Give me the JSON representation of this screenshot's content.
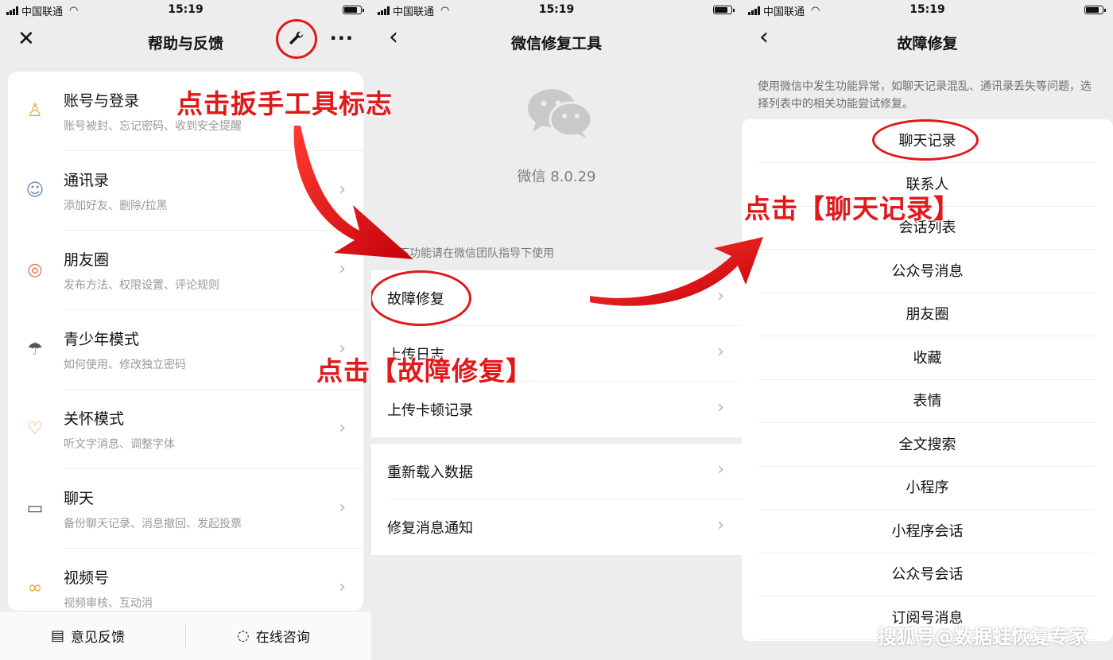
{
  "status": {
    "carrier": "中国联通",
    "time": "15:19"
  },
  "help": {
    "title": "帮助与反馈",
    "items": [
      {
        "icon": "user-icon",
        "title": "账号与登录",
        "sub": "账号被封、忘记密码、收到安全提醒"
      },
      {
        "icon": "contacts-icon",
        "title": "通讯录",
        "sub": "添加好友、删除/拉黑"
      },
      {
        "icon": "moments-icon",
        "title": "朋友圈",
        "sub": "发布方法、权限设置、评论规则"
      },
      {
        "icon": "umbrella-icon",
        "title": "青少年模式",
        "sub": "如何使用、修改独立密码"
      },
      {
        "icon": "care-icon",
        "title": "关怀模式",
        "sub": "听文字消息、调整字体"
      },
      {
        "icon": "chat-icon",
        "title": "聊天",
        "sub": "备份聊天记录、消息撤回、发起投票"
      },
      {
        "icon": "channels-icon",
        "title": "视频号",
        "sub": "视频审核、互动消"
      }
    ],
    "bottom": {
      "feedback": "意见反馈",
      "consult": "在线咨询"
    }
  },
  "repair": {
    "title": "微信修复工具",
    "version": "微信 8.0.29",
    "hint": "以下功能请在微信团队指导下使用",
    "rows": [
      "故障修复",
      "上传日志",
      "上传卡顿记录"
    ],
    "rows2": [
      "重新载入数据",
      "修复消息通知"
    ]
  },
  "fault": {
    "title": "故障修复",
    "desc": "使用微信中发生功能异常，如聊天记录混乱、通讯录丢失等问题，选择列表中的相关功能尝试修复。",
    "items": [
      "聊天记录",
      "联系人",
      "会话列表",
      "公众号消息",
      "朋友圈",
      "收藏",
      "表情",
      "全文搜索",
      "小程序",
      "小程序会话",
      "公众号会话",
      "订阅号消息"
    ]
  },
  "annotations": {
    "step1": "点击扳手工具标志",
    "step2": "点击【故障修复】",
    "step3": "点击【聊天记录】"
  },
  "watermark": "搜狐号@数据蛙恢复专家",
  "colors": {
    "annotation": "#e0191b",
    "wechat_gray": "#c9c9c9"
  }
}
